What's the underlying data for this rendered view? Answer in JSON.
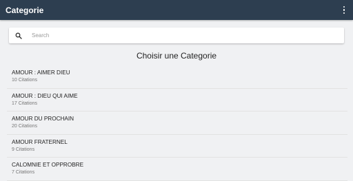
{
  "appbar": {
    "title": "Categorie",
    "menu_icon": "more-vert-icon"
  },
  "search": {
    "placeholder": "Search",
    "icon": "search-icon"
  },
  "section": {
    "title": "Choisir une Categorie"
  },
  "categories": [
    {
      "title": "AMOUR : AIMER DIEU",
      "count": "10 Citations"
    },
    {
      "title": "AMOUR : DIEU QUI AIME",
      "count": "17 Citations"
    },
    {
      "title": "AMOUR DU PROCHAIN",
      "count": "20 Citations"
    },
    {
      "title": "AMOUR FRATERNEL",
      "count": "9 Citations"
    },
    {
      "title": "CALOMNIE ET OPPROBRE",
      "count": "7 Citations"
    }
  ],
  "colors": {
    "appbar": "#2d3e50",
    "background": "#f0f1f3"
  }
}
